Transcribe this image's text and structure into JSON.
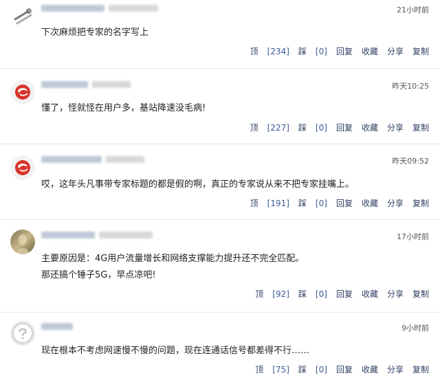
{
  "comments": [
    {
      "time": "21小时前",
      "lines": [
        "下次麻烦把专家的名字写上"
      ],
      "up": "234",
      "down": "0",
      "avatar_icon": "wrench-icon"
    },
    {
      "time": "昨天10:25",
      "lines": [
        "懂了，怪就怪在用户多，基站降速没毛病!"
      ],
      "up": "227",
      "down": "0",
      "avatar_icon": "red-swirl-logo-icon"
    },
    {
      "time": "昨天09:52",
      "lines": [
        "哎，这年头凡事带专家标题的都是假的啊，真正的专家说从来不把专家挂嘴上。"
      ],
      "up": "191",
      "down": "0",
      "avatar_icon": "red-swirl-logo-icon"
    },
    {
      "time": "17小时前",
      "lines": [
        "主要原因是：4G用户流量增长和网络支撑能力提升还不完全匹配。",
        "那还搞个锤子5G，早点凉吧!"
      ],
      "up": "92",
      "down": "0",
      "avatar_icon": "photo-avatar-icon"
    },
    {
      "time": "9小时前",
      "lines": [
        "现在根本不考虑网速慢不慢的问题，现在连通话信号都差得不行……"
      ],
      "up": "75",
      "down": "0",
      "avatar_icon": "default-user-icon"
    }
  ],
  "labels": {
    "up": "顶",
    "down": "踩",
    "reply": "回复",
    "favorite": "收藏",
    "share": "分享",
    "copy": "复制"
  },
  "colors": {
    "action_text": "#2e3e63",
    "divider": "#e6e6e6",
    "logo_red": "#d9342b"
  }
}
